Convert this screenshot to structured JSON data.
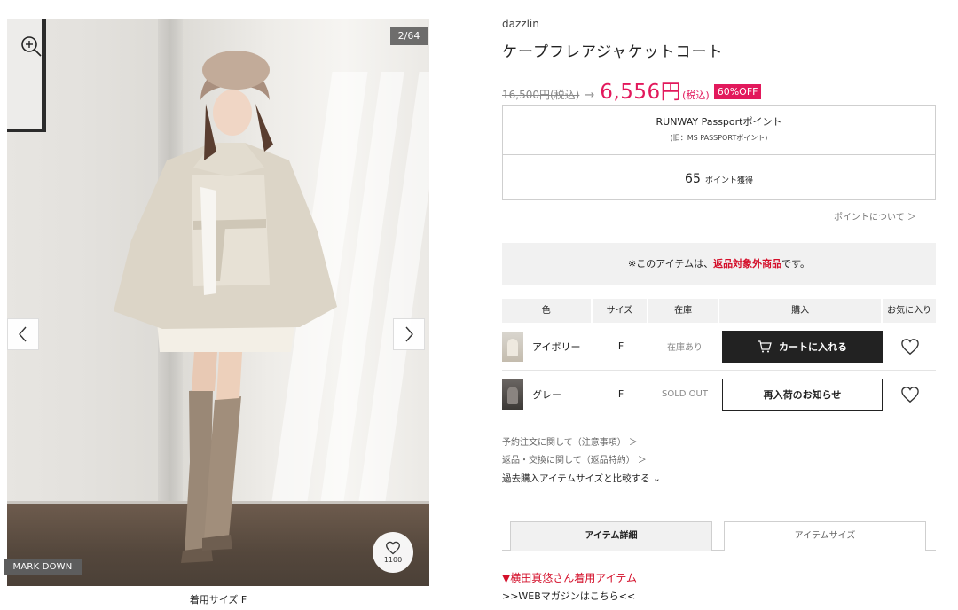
{
  "gallery": {
    "counter": "2/64",
    "favorite_count": "1100",
    "markdown_badge": "MARK DOWN",
    "caption": "着用サイズ F"
  },
  "product": {
    "brand": "dazzlin",
    "title": "ケープフレアジャケットコート",
    "old_price": "16,500円(税込)",
    "arrow": "→",
    "new_price": "6,556円",
    "new_price_tax": "(税込)",
    "discount_badge": "60%OFF"
  },
  "points": {
    "title": "RUNWAY Passportポイント",
    "subtitle": "(旧：MS PASSPORTポイント)",
    "value": "65",
    "unit": "ポイント獲得",
    "about_link": "ポイントについて ＞"
  },
  "notice": {
    "prefix": "※このアイテムは、",
    "highlight": "返品対象外商品",
    "suffix": "です。"
  },
  "table": {
    "headers": [
      "色",
      "サイズ",
      "在庫",
      "購入",
      "お気に入り"
    ],
    "rows": [
      {
        "color": "アイボリー",
        "size": "F",
        "stock": "在庫あり",
        "action": "カートに入れる"
      },
      {
        "color": "グレー",
        "size": "F",
        "stock": "SOLD OUT",
        "action": "再入荷のお知らせ"
      }
    ]
  },
  "links": {
    "preorder": "予約注文に関して（注意事項） ＞",
    "returns": "返品・交換に関して（返品特約） ＞",
    "compare": "過去購入アイテムサイズと比較する ⌄"
  },
  "tabs": {
    "details": "アイテム詳細",
    "size": "アイテムサイズ"
  },
  "model": {
    "wearing": "▼横田真悠さん着用アイテム",
    "web_link": ">>WEBマガジンはこちら<<"
  },
  "colors": {
    "accent": "#e2195c",
    "notice_red": "#d40f2a",
    "button_dark": "#222222"
  }
}
